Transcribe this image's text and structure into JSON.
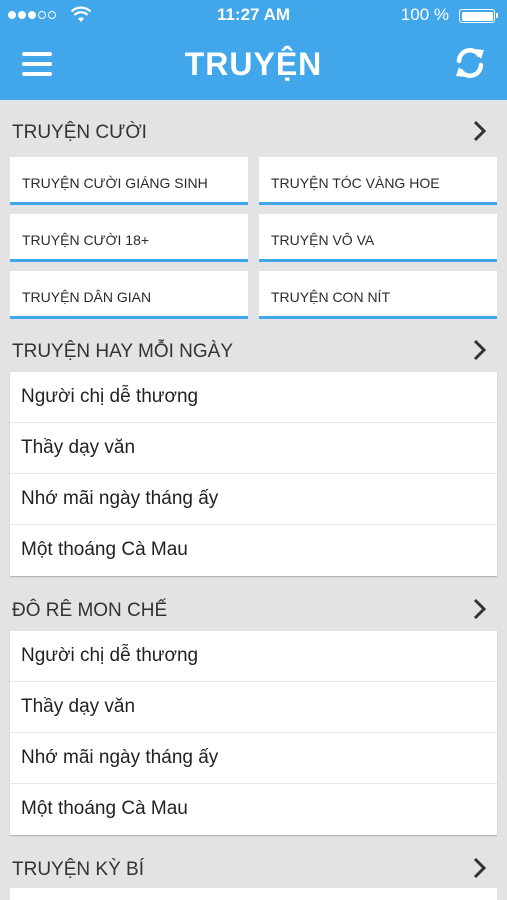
{
  "status_bar": {
    "time": "11:27 AM",
    "battery": "100 %"
  },
  "header": {
    "title": "TRUYỆN"
  },
  "icons": {
    "menu": "hamburger-icon",
    "refresh": "refresh-icon",
    "chevron": "chevron-right-icon",
    "wifi": "wifi-icon",
    "battery": "battery-icon"
  },
  "colors": {
    "accent": "#41a7ea",
    "background": "#e3e3e6"
  },
  "sections": [
    {
      "title": "TRUYỆN CƯỜI",
      "tiles": [
        "TRUYỆN CƯỜI GIÁNG SINH",
        "TRUYỆN TÓC VÀNG HOE",
        "TRUYỆN CƯỜI 18+",
        "TRUYỆN VÔ VA",
        "TRUYỆN DÂN GIAN",
        "TRUYỆN CON NÍT"
      ]
    },
    {
      "title": "TRUYỆN HAY MỖI NGÀY",
      "items": [
        "Người chị dễ thương",
        "Thầy dạy văn",
        "Nhớ mãi ngày tháng ấy",
        "Một thoáng Cà Mau"
      ]
    },
    {
      "title": "ĐÔ RÊ MON CHẾ",
      "items": [
        "Người chị dễ thương",
        "Thầy dạy văn",
        "Nhớ mãi ngày tháng ấy",
        "Một thoáng Cà Mau"
      ]
    },
    {
      "title": "TRUYỆN KỲ BÍ"
    }
  ]
}
